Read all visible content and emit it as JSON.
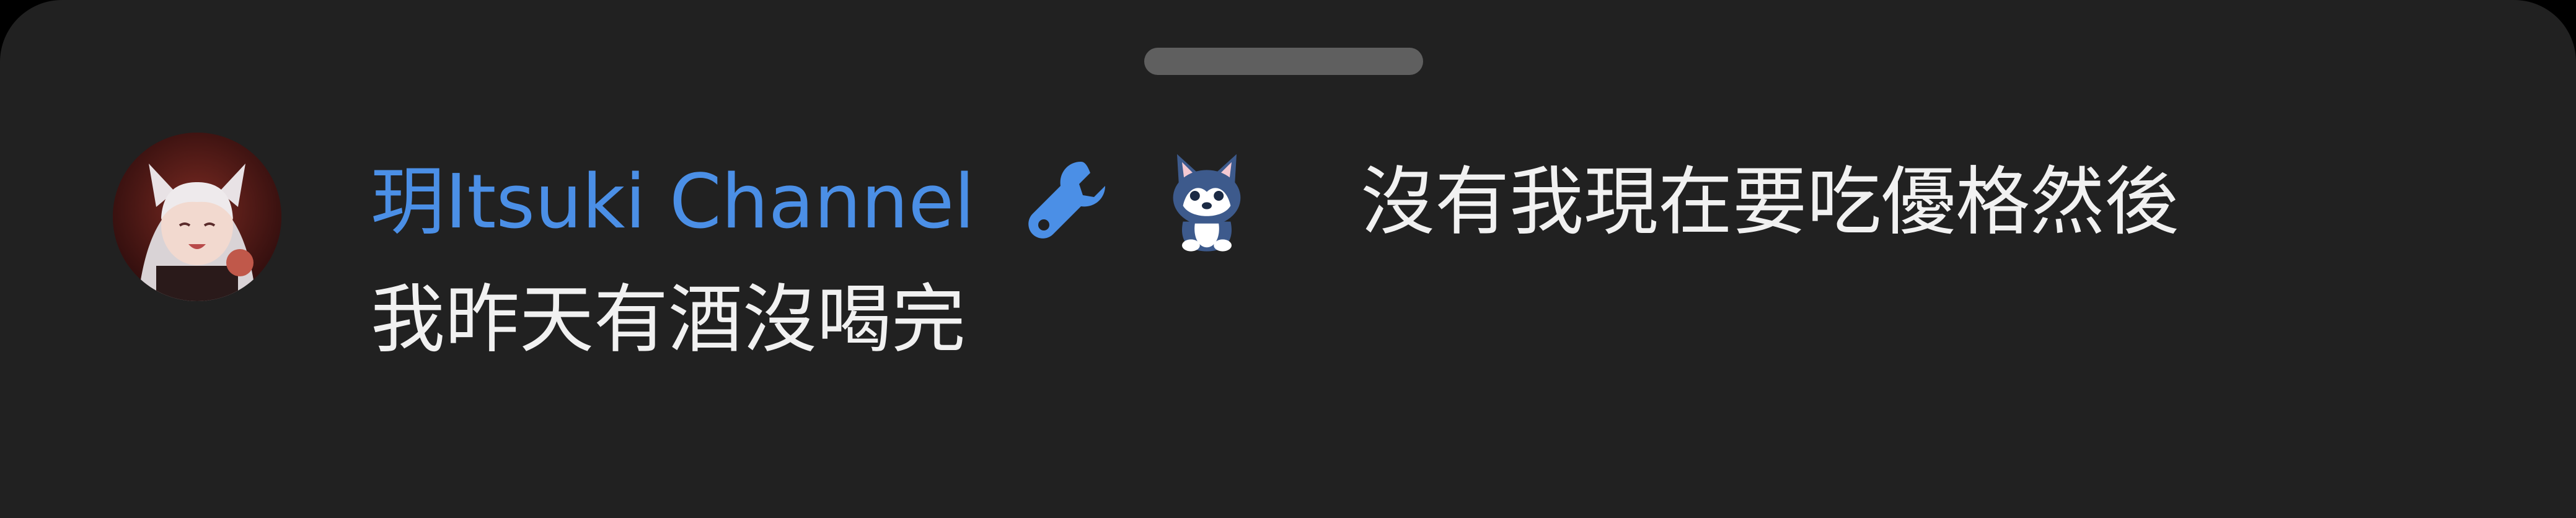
{
  "author": {
    "name": "玥Itsuki Channel",
    "badges": [
      "wrench-icon",
      "husky-membership-badge"
    ]
  },
  "comment": {
    "line1": "沒有我現在要吃優格然後",
    "line2": "我昨天有酒沒喝完"
  },
  "colors": {
    "background": "#212121",
    "author_name": "#4b8fe6",
    "text": "#f1f1f1",
    "handle": "#5f5f5f"
  }
}
